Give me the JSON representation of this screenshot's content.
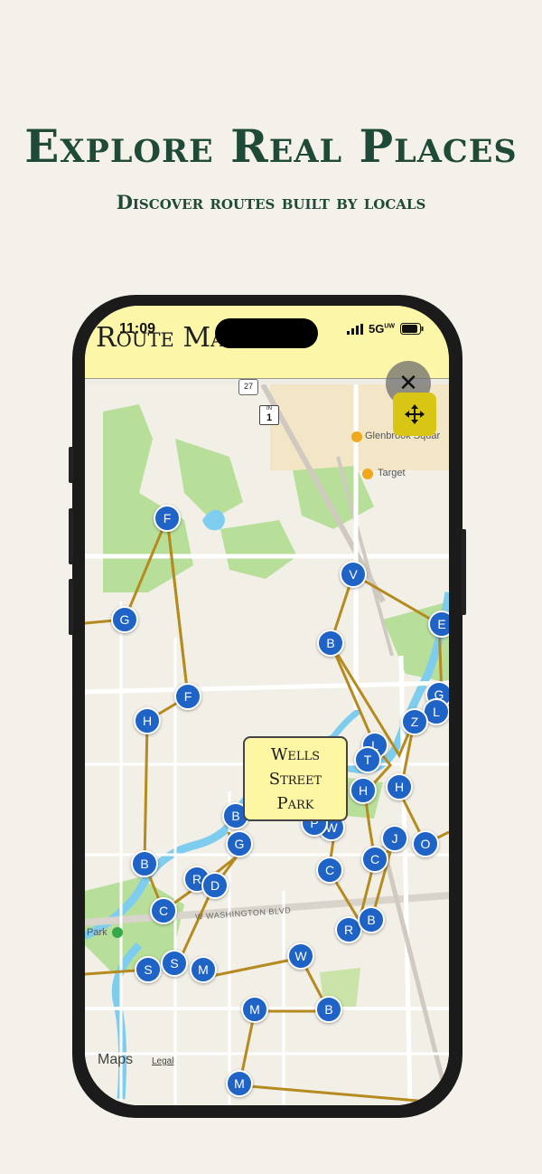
{
  "headline": "Explore Real Places",
  "subheadline": "Discover routes built by locals",
  "status_bar": {
    "time": "11:09",
    "network": "5G",
    "network_sub": "UW"
  },
  "app": {
    "title": "Route Map"
  },
  "map": {
    "popup_lines": [
      "Wells",
      "Street",
      "Park"
    ],
    "labels": {
      "poi_glenbrook": "Glenbrook Squar",
      "poi_target": "Target",
      "park": "Park",
      "street_washington": "W WASHINGTON BLVD",
      "shield_27": "27",
      "shield_1": "1",
      "shield_1_top": "IN"
    },
    "attribution": {
      "maps": "Maps",
      "legal": "Legal"
    },
    "pins": [
      "F",
      "G",
      "V",
      "B",
      "E",
      "F",
      "H",
      "G",
      "L",
      "Z",
      "L",
      "T",
      "W",
      "H",
      "H",
      "B",
      "W",
      "P",
      "G",
      "J",
      "O",
      "C",
      "C",
      "B",
      "C",
      "R",
      "D",
      "R",
      "B",
      "S",
      "S",
      "M",
      "W",
      "M",
      "B",
      "M"
    ]
  },
  "controls": {
    "close_icon": "close-icon",
    "locate_icon": "move-arrows-icon"
  },
  "colors": {
    "background": "#f4f1ea",
    "headline": "#1f4a37",
    "header": "#fbf6a8",
    "pin": "#1f63c6",
    "route": "#b58a1f",
    "water": "#7fcdee",
    "park": "#b7df9a",
    "locate_button": "#d8c514"
  }
}
